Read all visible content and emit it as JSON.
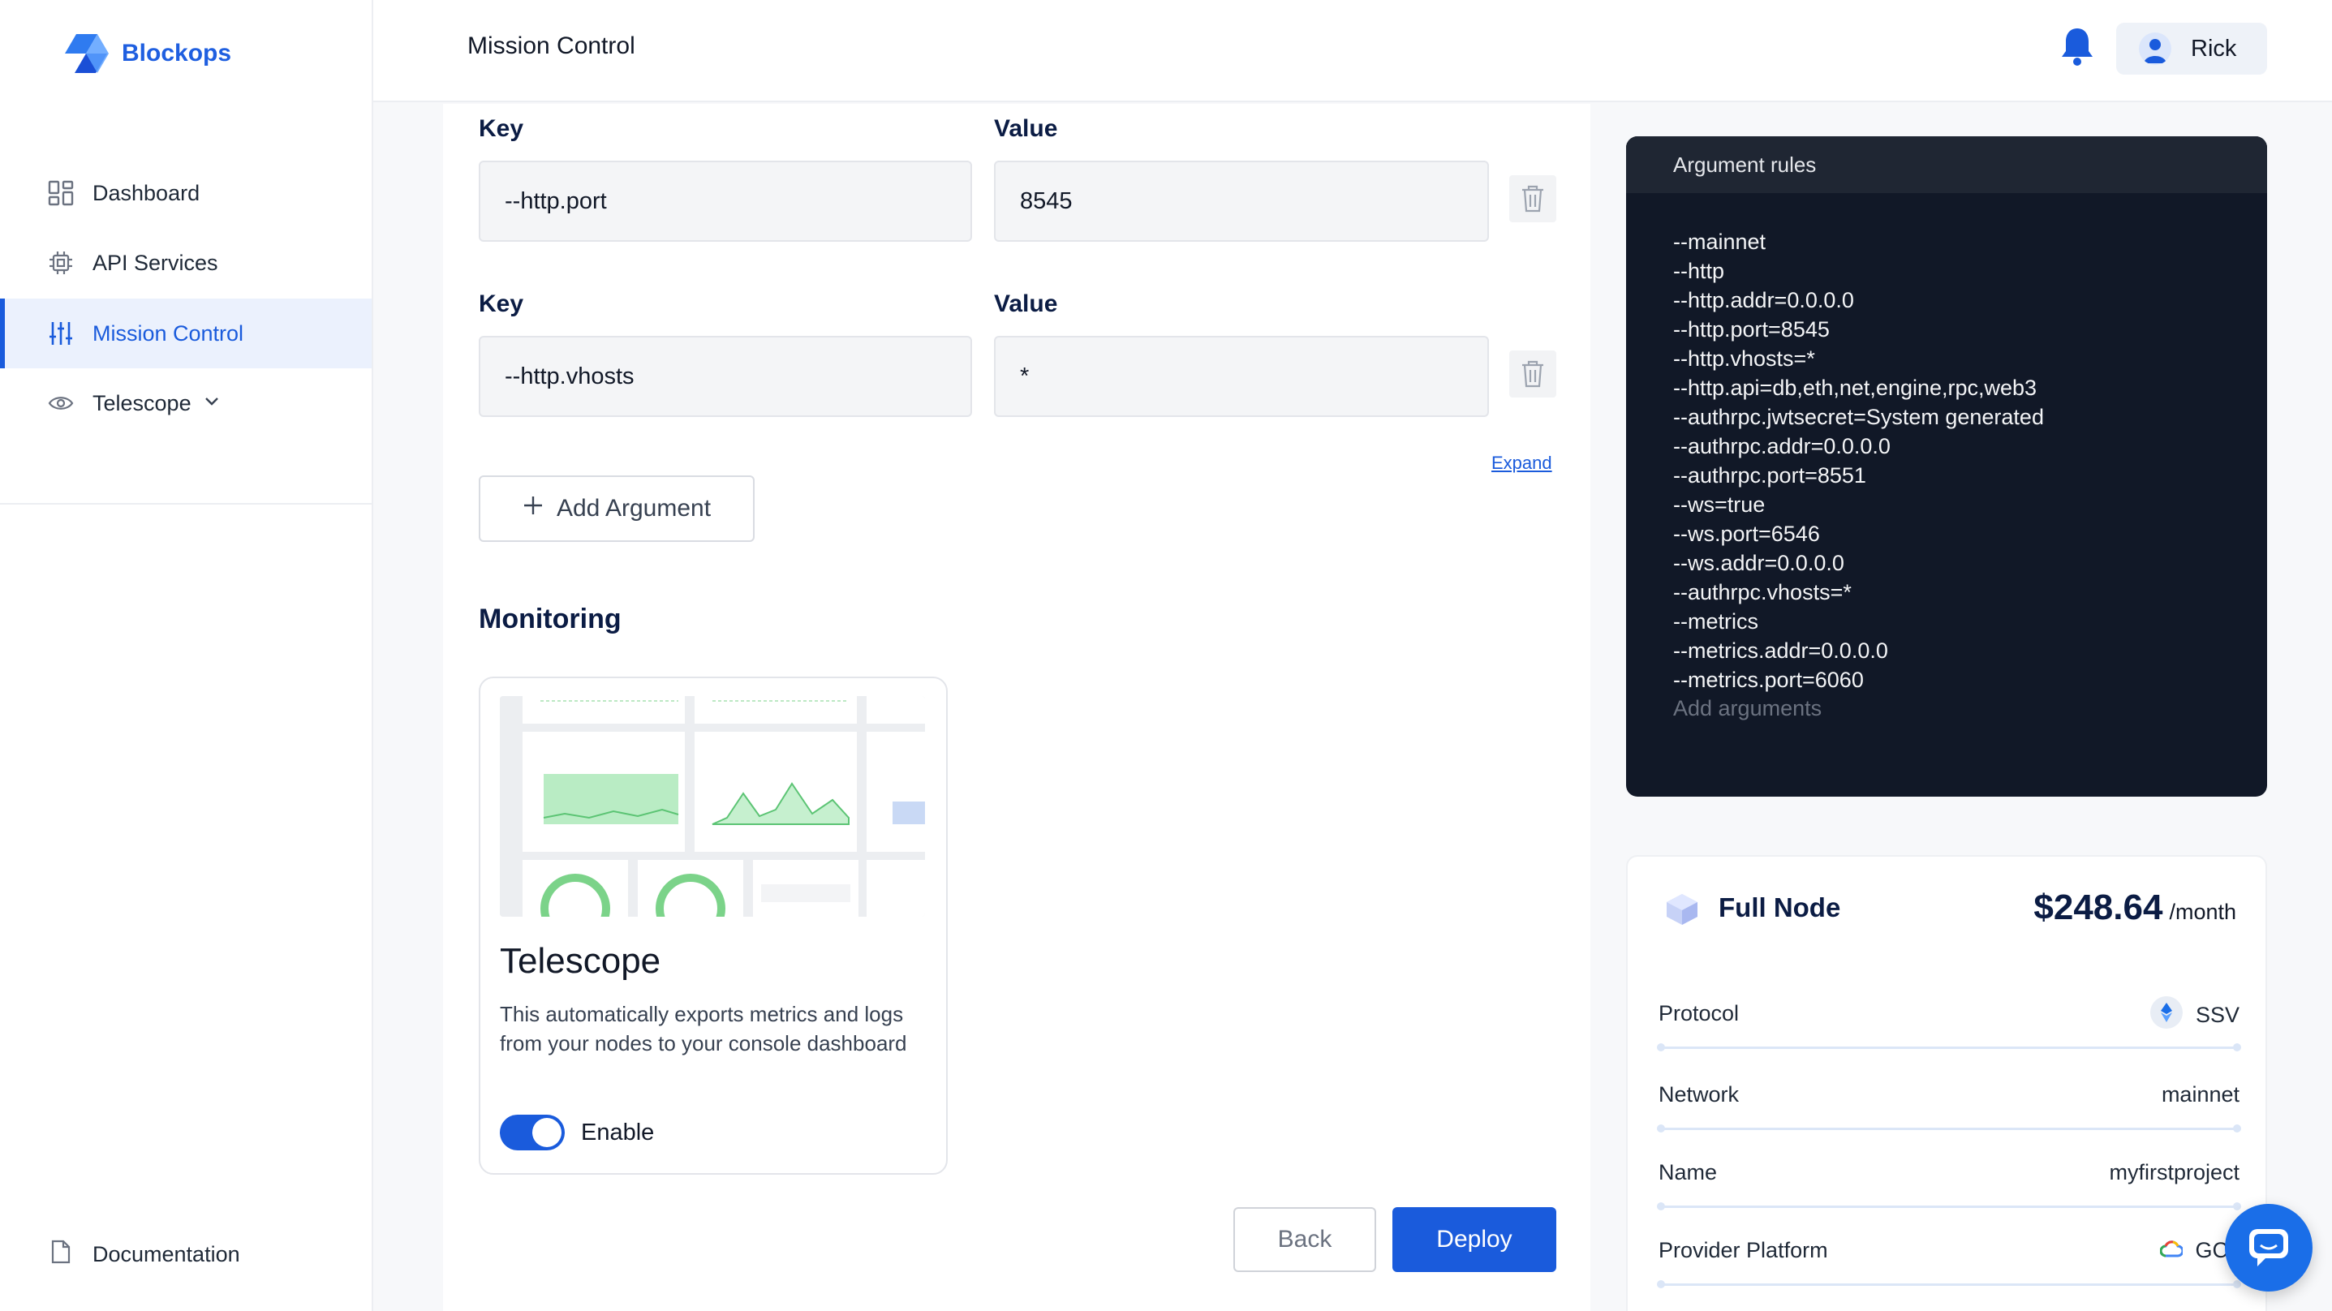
{
  "brand": {
    "name": "Blockops"
  },
  "sidebar": {
    "items": [
      {
        "label": "Dashboard"
      },
      {
        "label": "API Services"
      },
      {
        "label": "Mission Control"
      },
      {
        "label": "Telescope"
      }
    ],
    "documentation": "Documentation"
  },
  "header": {
    "title": "Mission Control",
    "user": "Rick"
  },
  "arguments": {
    "key_label": "Key",
    "value_label": "Value",
    "rows": [
      {
        "key": "--http.port",
        "value": "8545"
      },
      {
        "key": "--http.vhosts",
        "value": "*"
      }
    ],
    "expand": "Expand",
    "add_button": "Add Argument"
  },
  "monitoring": {
    "title": "Monitoring",
    "card_title": "Telescope",
    "description": "This automatically exports metrics and logs from your nodes to your console dashboard",
    "toggle_label": "Enable",
    "toggle_on": true
  },
  "actions": {
    "back": "Back",
    "deploy": "Deploy"
  },
  "rules": {
    "title": "Argument rules",
    "lines": [
      "--mainnet",
      "--http",
      "--http.addr=0.0.0.0",
      "--http.port=8545",
      "--http.vhosts=*",
      "--http.api=db,eth,net,engine,rpc,web3",
      "--authrpc.jwtsecret=System generated",
      "--authrpc.addr=0.0.0.0",
      "--authrpc.port=8551",
      "--ws=true",
      "--ws.port=6546",
      "--ws.addr=0.0.0.0",
      "--authrpc.vhosts=*",
      "--metrics",
      "--metrics.addr=0.0.0.0",
      "--metrics.port=6060"
    ],
    "placeholder": "Add arguments"
  },
  "node": {
    "title": "Full Node",
    "price": "$248.64",
    "price_unit": "/month",
    "rows": [
      {
        "label": "Protocol",
        "value": "SSV",
        "icon": "ssv-icon"
      },
      {
        "label": "Network",
        "value": "mainnet"
      },
      {
        "label": "Name",
        "value": "myfirstproject"
      },
      {
        "label": "Provider Platform",
        "value": "GC",
        "icon": "google-cloud-icon"
      }
    ]
  },
  "colors": {
    "accent": "#1a5bdc",
    "dark_panel": "#111827"
  }
}
